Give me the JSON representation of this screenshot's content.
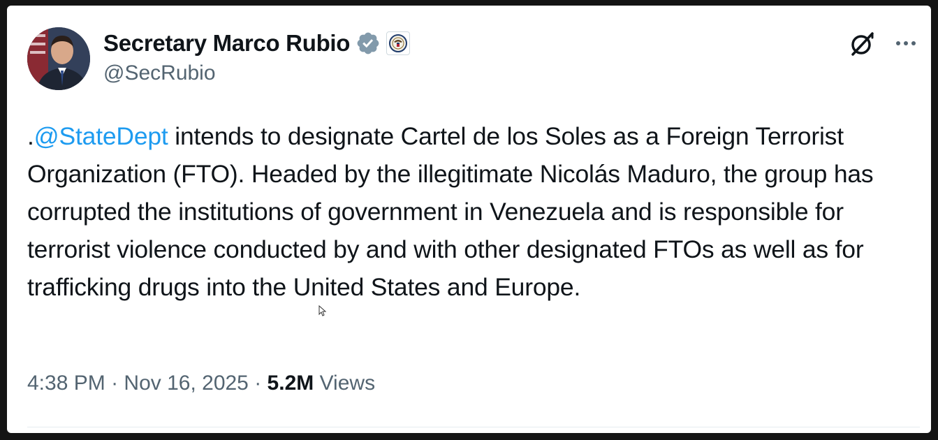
{
  "author": {
    "display_name": "Secretary Marco Rubio",
    "handle": "@SecRubio",
    "avatar_icon": "profile-photo",
    "verified_icon": "verified-badge-icon",
    "affiliation_icon": "state-department-seal-icon"
  },
  "header_actions": {
    "grok_icon": "grok-icon",
    "more_icon": "more-options-icon"
  },
  "tweet": {
    "prefix": ".",
    "mention": "@StateDept",
    "body": " intends to designate Cartel de los Soles as a Foreign Terrorist Organization (FTO). Headed by the illegitimate Nicolás Maduro, the group has corrupted the institutions of government in Venezuela and is responsible for terrorist violence conducted by and with other designated FTOs as well as for trafficking drugs into the United States and Europe."
  },
  "meta": {
    "time": "4:38 PM",
    "separator": " · ",
    "date": "Nov 16, 2025",
    "views_count": "5.2M",
    "views_label": " Views"
  },
  "colors": {
    "link": "#1d9bf0",
    "verified": "#1d9bf0",
    "text": "#0f1419",
    "secondary": "#536471"
  }
}
